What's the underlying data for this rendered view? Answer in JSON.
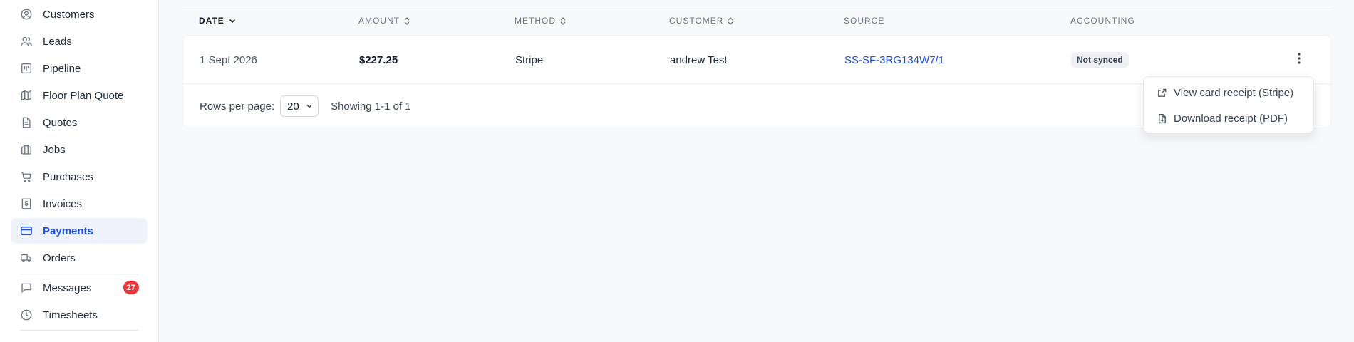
{
  "sidebar": {
    "items": [
      {
        "label": "Customers",
        "icon": "user-circle-icon"
      },
      {
        "label": "Leads",
        "icon": "users-icon"
      },
      {
        "label": "Pipeline",
        "icon": "kanban-icon"
      },
      {
        "label": "Floor Plan Quote",
        "icon": "map-icon"
      },
      {
        "label": "Quotes",
        "icon": "document-icon"
      },
      {
        "label": "Jobs",
        "icon": "briefcase-icon"
      },
      {
        "label": "Purchases",
        "icon": "cart-icon"
      },
      {
        "label": "Invoices",
        "icon": "dollar-document-icon"
      },
      {
        "label": "Payments",
        "icon": "credit-card-icon",
        "active": true
      },
      {
        "label": "Orders",
        "icon": "truck-icon"
      },
      {
        "label": "Messages",
        "icon": "chat-icon",
        "badge": "27"
      },
      {
        "label": "Timesheets",
        "icon": "clock-icon"
      }
    ]
  },
  "table": {
    "columns": [
      {
        "label": "Date",
        "sortable": true,
        "sorted": "desc"
      },
      {
        "label": "Amount",
        "sortable": true
      },
      {
        "label": "Method",
        "sortable": true
      },
      {
        "label": "Customer",
        "sortable": true
      },
      {
        "label": "Source",
        "sortable": false
      },
      {
        "label": "Accounting",
        "sortable": false
      }
    ],
    "rows": [
      {
        "date": "1 Sept 2026",
        "amount": "$227.25",
        "method": "Stripe",
        "customer": "andrew Test",
        "source": "SS-SF-3RG134W7/1",
        "accounting": "Not synced"
      }
    ]
  },
  "pagination": {
    "rows_per_page_label": "Rows per page:",
    "rows_per_page_value": "20",
    "showing": "Showing 1-1 of 1"
  },
  "row_menu": {
    "items": [
      {
        "label": "View card receipt (Stripe)",
        "icon": "external-link-icon"
      },
      {
        "label": "Download receipt (PDF)",
        "icon": "file-download-icon"
      }
    ]
  },
  "colors": {
    "accent": "#1d4ed8",
    "active_bg": "#eef2fa",
    "badge_red": "#e5383b"
  }
}
